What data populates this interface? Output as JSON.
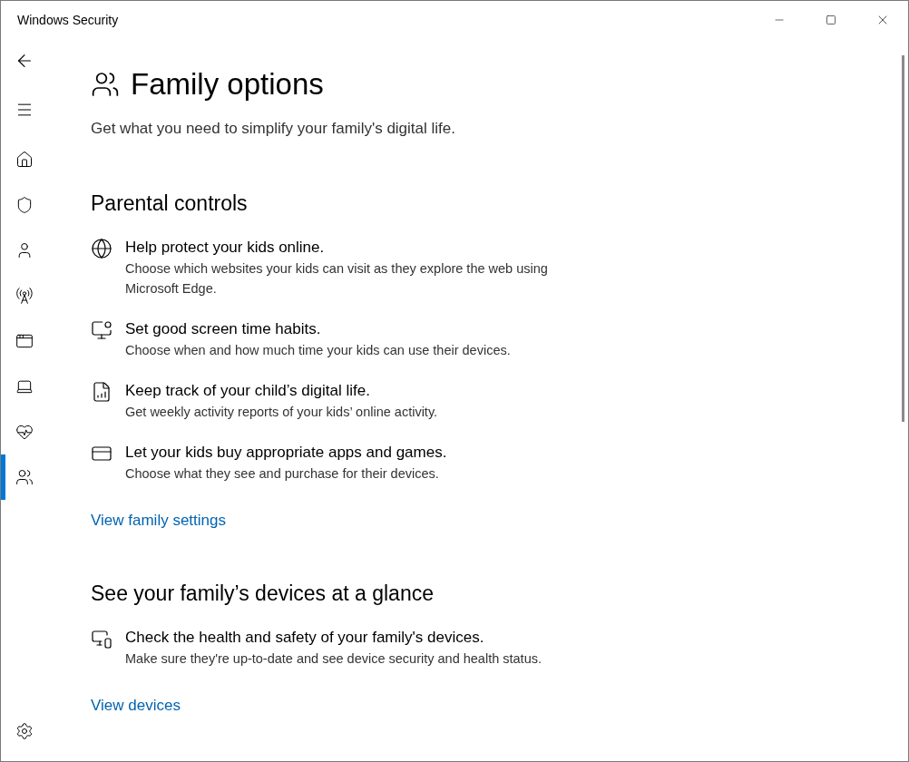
{
  "window": {
    "title": "Windows Security"
  },
  "nav": [
    {
      "kind": "home",
      "selected": false
    },
    {
      "kind": "shield",
      "selected": false
    },
    {
      "kind": "account",
      "selected": false
    },
    {
      "kind": "network",
      "selected": false
    },
    {
      "kind": "app",
      "selected": false
    },
    {
      "kind": "device",
      "selected": false
    },
    {
      "kind": "health",
      "selected": false
    },
    {
      "kind": "family",
      "selected": true
    }
  ],
  "page": {
    "title": "Family options",
    "subtitle": "Get what you need to simplify your family's digital life."
  },
  "sections": [
    {
      "heading": "Parental controls",
      "items": [
        {
          "kind": "web",
          "title": "Help protect your kids online.",
          "description": "Choose which websites your kids can visit as they explore the web using Microsoft Edge."
        },
        {
          "kind": "screen-time",
          "title": "Set good screen time habits.",
          "description": "Choose when and how much time your kids can use their devices."
        },
        {
          "kind": "report",
          "title": "Keep track of your child’s digital life.",
          "description": "Get weekly activity reports of your kids’ online activity."
        },
        {
          "kind": "card",
          "title": "Let your kids buy appropriate apps and games.",
          "description": "Choose what they see and purchase for their devices."
        }
      ],
      "link": "View family settings"
    },
    {
      "heading": "See your family’s devices at a glance",
      "items": [
        {
          "kind": "devices",
          "title": "Check the health and safety of your family's devices.",
          "description": "Make sure they're up-to-date and see device security and health status."
        }
      ],
      "link": "View devices"
    }
  ]
}
